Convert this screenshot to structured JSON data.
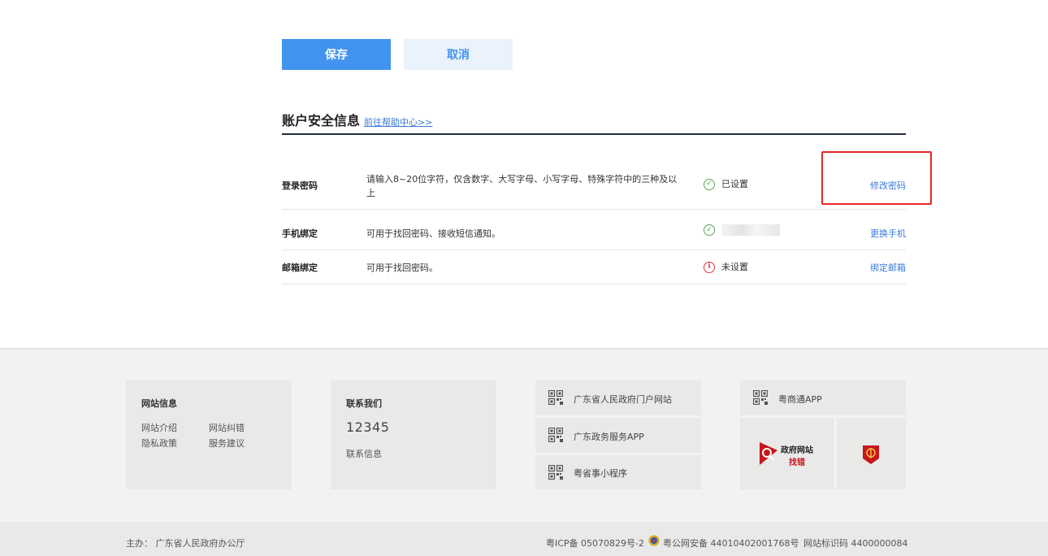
{
  "actions": {
    "save_label": "保存",
    "cancel_label": "取消"
  },
  "security": {
    "title": "账户安全信息",
    "help_link": "前往帮助中心>>",
    "rows": [
      {
        "label": "登录密码",
        "desc_line1": "请输入8~20位字符，仅含数字、大写字母、小写字母、特殊字符中的三种及以",
        "desc_line2": "上",
        "status": "已设置",
        "status_icon": "check-circle-icon",
        "action": "修改密码"
      },
      {
        "label": "手机绑定",
        "desc": "可用于找回密码、接收短信通知。",
        "status_icon": "check-circle-icon",
        "action": "更换手机"
      },
      {
        "label": "邮箱绑定",
        "desc": "可用于找回密码。",
        "status": "未设置",
        "status_icon": "info-circle-icon",
        "action": "绑定邮箱"
      }
    ],
    "colors": {
      "accent": "#4193ee",
      "ok": "#56a65a",
      "warn": "#e5353a",
      "highlight": "#e8262a"
    }
  },
  "footer": {
    "site_info": {
      "title": "网站信息",
      "links": [
        "网站介绍",
        "网站纠错",
        "隐私政策",
        "服务建议"
      ]
    },
    "contact": {
      "title": "联系我们",
      "phone": "12345",
      "link": "联系信息"
    },
    "qr_items": [
      "广东省人民政府门户网站",
      "广东政务服务APP",
      "粤省事小程序",
      "粤商通APP"
    ],
    "badge": {
      "text_top": "政府网站",
      "text_bottom": "找错"
    },
    "sponsor": "主办：  广东省人民政府办公厅",
    "icp": "粤ICP备 05070829号-2",
    "police": "粤公网安备 44010402001768号",
    "site_code": "网站标识码 4400000084"
  }
}
